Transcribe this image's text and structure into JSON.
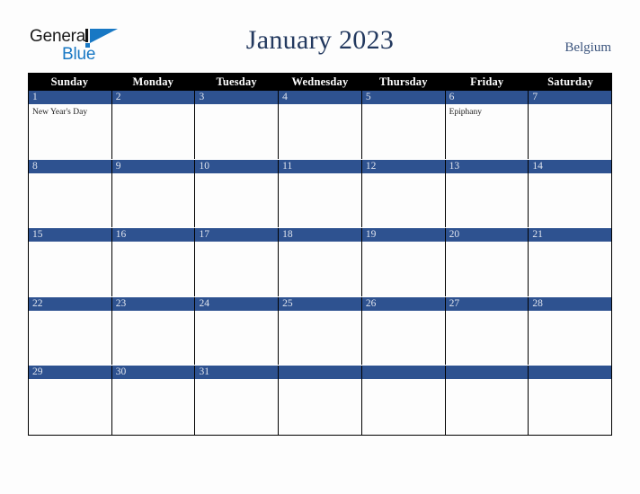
{
  "brand": {
    "word_one": "General",
    "word_two": "Blue",
    "mark_icon": "triangle-flag-icon",
    "accent_color": "#1878c4",
    "dark_color": "#111111"
  },
  "header": {
    "title": "January 2023",
    "country": "Belgium",
    "title_color": "#23395f",
    "country_color": "#3b547d"
  },
  "calendar": {
    "weekday_header_bg": "#000000",
    "weekday_header_fg": "#ffffff",
    "day_header_bg": "#2e5290",
    "day_header_fg": "#dfe4ee",
    "grid_line_color": "#000000",
    "cell_bg": "#fdfdfd",
    "weekdays": [
      "Sunday",
      "Monday",
      "Tuesday",
      "Wednesday",
      "Thursday",
      "Friday",
      "Saturday"
    ],
    "weeks": [
      [
        {
          "num": "1",
          "event": "New Year's Day"
        },
        {
          "num": "2",
          "event": ""
        },
        {
          "num": "3",
          "event": ""
        },
        {
          "num": "4",
          "event": ""
        },
        {
          "num": "5",
          "event": ""
        },
        {
          "num": "6",
          "event": "Epiphany"
        },
        {
          "num": "7",
          "event": ""
        }
      ],
      [
        {
          "num": "8",
          "event": ""
        },
        {
          "num": "9",
          "event": ""
        },
        {
          "num": "10",
          "event": ""
        },
        {
          "num": "11",
          "event": ""
        },
        {
          "num": "12",
          "event": ""
        },
        {
          "num": "13",
          "event": ""
        },
        {
          "num": "14",
          "event": ""
        }
      ],
      [
        {
          "num": "15",
          "event": ""
        },
        {
          "num": "16",
          "event": ""
        },
        {
          "num": "17",
          "event": ""
        },
        {
          "num": "18",
          "event": ""
        },
        {
          "num": "19",
          "event": ""
        },
        {
          "num": "20",
          "event": ""
        },
        {
          "num": "21",
          "event": ""
        }
      ],
      [
        {
          "num": "22",
          "event": ""
        },
        {
          "num": "23",
          "event": ""
        },
        {
          "num": "24",
          "event": ""
        },
        {
          "num": "25",
          "event": ""
        },
        {
          "num": "26",
          "event": ""
        },
        {
          "num": "27",
          "event": ""
        },
        {
          "num": "28",
          "event": ""
        }
      ],
      [
        {
          "num": "29",
          "event": ""
        },
        {
          "num": "30",
          "event": ""
        },
        {
          "num": "31",
          "event": ""
        },
        {
          "num": "",
          "event": ""
        },
        {
          "num": "",
          "event": ""
        },
        {
          "num": "",
          "event": ""
        },
        {
          "num": "",
          "event": ""
        }
      ]
    ]
  }
}
